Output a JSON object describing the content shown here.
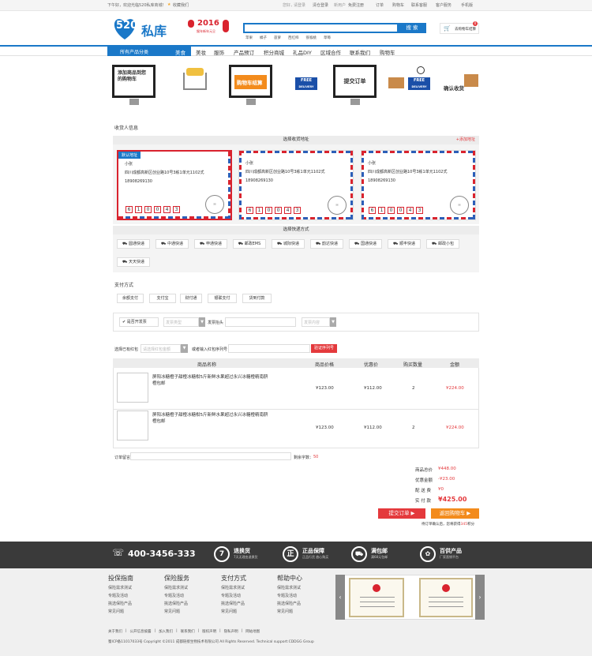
{
  "topbar": {
    "greeting": "下午好，欢迎光临520私库商城！",
    "login": "请登录",
    "links": [
      "订单",
      "购物车",
      "联系客服",
      "客户服务",
      "手机版"
    ],
    "promo_a": "清仓登录",
    "promo_b": "免费注册",
    "favorite": "收藏我们"
  },
  "logo": {
    "text": "520私库",
    "badge_year": "2016",
    "badge_sub": "猴年新年元旦"
  },
  "search": {
    "placeholder": "",
    "button": "搜 索",
    "hot": [
      "苹果",
      "橘子",
      "菠萝",
      "西红柿",
      "猕猴桃",
      "草莓"
    ]
  },
  "cart_button": "去购物车结算",
  "cart_count": "0",
  "nav": {
    "all": "所有产品分类",
    "items": [
      "美食",
      "美妆",
      "服饰",
      "产品预订",
      "积分商城",
      "礼品DIY",
      "区域合作",
      "联系我们",
      "购物车"
    ]
  },
  "steps": {
    "s1": "添加商品到您的购物车",
    "s2": "购物车结算",
    "s3": "提交订单",
    "s4": "确认收货",
    "free": "FREE",
    "delivery": "DELIVERY"
  },
  "receiver": {
    "section_title": "收货人信息",
    "choose": "选择收货地址",
    "add_new": "+添加地址",
    "default_tag": "默认地址",
    "cards": [
      {
        "name": "小张",
        "address": "四川成都高新区创业路10号3栋1单元1102式",
        "phone": "18908269130",
        "zip": [
          "6",
          "1",
          "0",
          "0",
          "4",
          "3"
        ]
      },
      {
        "name": "小张",
        "address": "四川成都高新区创业路10号3栋1单元1102式",
        "phone": "18908269130",
        "zip": [
          "6",
          "1",
          "0",
          "0",
          "4",
          "3"
        ]
      },
      {
        "name": "小张",
        "address": "四川成都高新区创业路10号3栋1单元1102式",
        "phone": "18908269130",
        "zip": [
          "6",
          "1",
          "0",
          "0",
          "4",
          "3"
        ]
      }
    ]
  },
  "shipping": {
    "title": "选择快递方式",
    "options": [
      "圆通快递",
      "中通快递",
      "申通快递",
      "邮政EMS",
      "城际快递",
      "韵达快递",
      "国通快递",
      "顺丰快递",
      "邮政小包",
      "天天快递"
    ]
  },
  "payment": {
    "title": "支付方式",
    "options": [
      "余额支付",
      "支付宝",
      "财付通",
      "银联支付",
      "货到付款"
    ]
  },
  "invoice": {
    "checkbox_label": "是否开发票",
    "type_placeholder": "发票类型",
    "header_label": "发票抬头",
    "content_placeholder": "发票内容"
  },
  "coupon": {
    "label": "选择已有红包",
    "select_placeholder": "请选择红包金额",
    "code_label": "或者输入红包序列号",
    "verify_button": "验证序列号"
  },
  "table": {
    "headers": [
      "商品名称",
      "商品价格",
      "优惠价",
      "购买数量",
      "金额"
    ],
    "rows": [
      {
        "name": "屏阳冰糖橙子甜橙冰糖柑5斤新鲜水果超过永兴冰糖橙精南脐橙包邮",
        "price": "¥123.00",
        "sale": "¥112.00",
        "qty": "2",
        "amount": "¥224.00"
      },
      {
        "name": "屏阳冰糖橙子甜橙冰糖柑5斤新鲜水果超过永兴冰糖橙精南脐橙包邮",
        "price": "¥123.00",
        "sale": "¥112.00",
        "qty": "2",
        "amount": "¥224.00"
      }
    ]
  },
  "remark": {
    "label": "订单留言",
    "count_label": "剩余字数：",
    "count": "50"
  },
  "summary": {
    "total_label": "商品总价",
    "total": "¥448.00",
    "discount_label": "优惠金额",
    "discount": "-¥23.00",
    "shipping_label": "配 送 费",
    "shipping": "¥0",
    "pay_label": "实 付 款",
    "pay": "¥425.00",
    "submit": "提交订单",
    "back": "返回购物车",
    "points_prefix": "待订单确认后，您将获得",
    "points": "345",
    "points_suffix": "积分"
  },
  "footer_band": {
    "phone": "400-3456-333",
    "items": [
      {
        "icon": "7",
        "title": "退换货",
        "sub": "7天无理由退换货"
      },
      {
        "icon": "正",
        "title": "正品保障",
        "sub": "正品行货 放心购买"
      },
      {
        "icon": "",
        "title": "满包邮",
        "sub": "满68元包邮"
      },
      {
        "icon": "",
        "title": "百供产品",
        "sub": "厂家直销平台"
      }
    ]
  },
  "footer_links": [
    {
      "head": "投保指南",
      "items": [
        "保险需求测试",
        "专题及活动",
        "挑选保险产品",
        "常见问题"
      ]
    },
    {
      "head": "保险服务",
      "items": [
        "保险需求测试",
        "专题及活动",
        "挑选保险产品",
        "常见问题"
      ]
    },
    {
      "head": "支付方式",
      "items": [
        "保险需求测试",
        "专题及活动",
        "挑选保险产品",
        "常见问题"
      ]
    },
    {
      "head": "帮助中心",
      "items": [
        "保险需求测试",
        "专题及活动",
        "挑选保险产品",
        "常见问题"
      ]
    }
  ],
  "bottom_links": [
    "关于我们",
    "公开信息披露",
    "加入我们",
    "联系我们",
    "版权声明",
    "隐私声明",
    "网站地图"
  ],
  "copyright": "蜀ICP备11017033号 Copyright ©2011 成都链接生物技术有限公司 All Rights Reserved. Technical support:CDDGG Group",
  "colors": {
    "brand": "#1a78c8",
    "red": "#e4393c",
    "orange": "#f38b1c",
    "dark": "#3a3a3a"
  }
}
